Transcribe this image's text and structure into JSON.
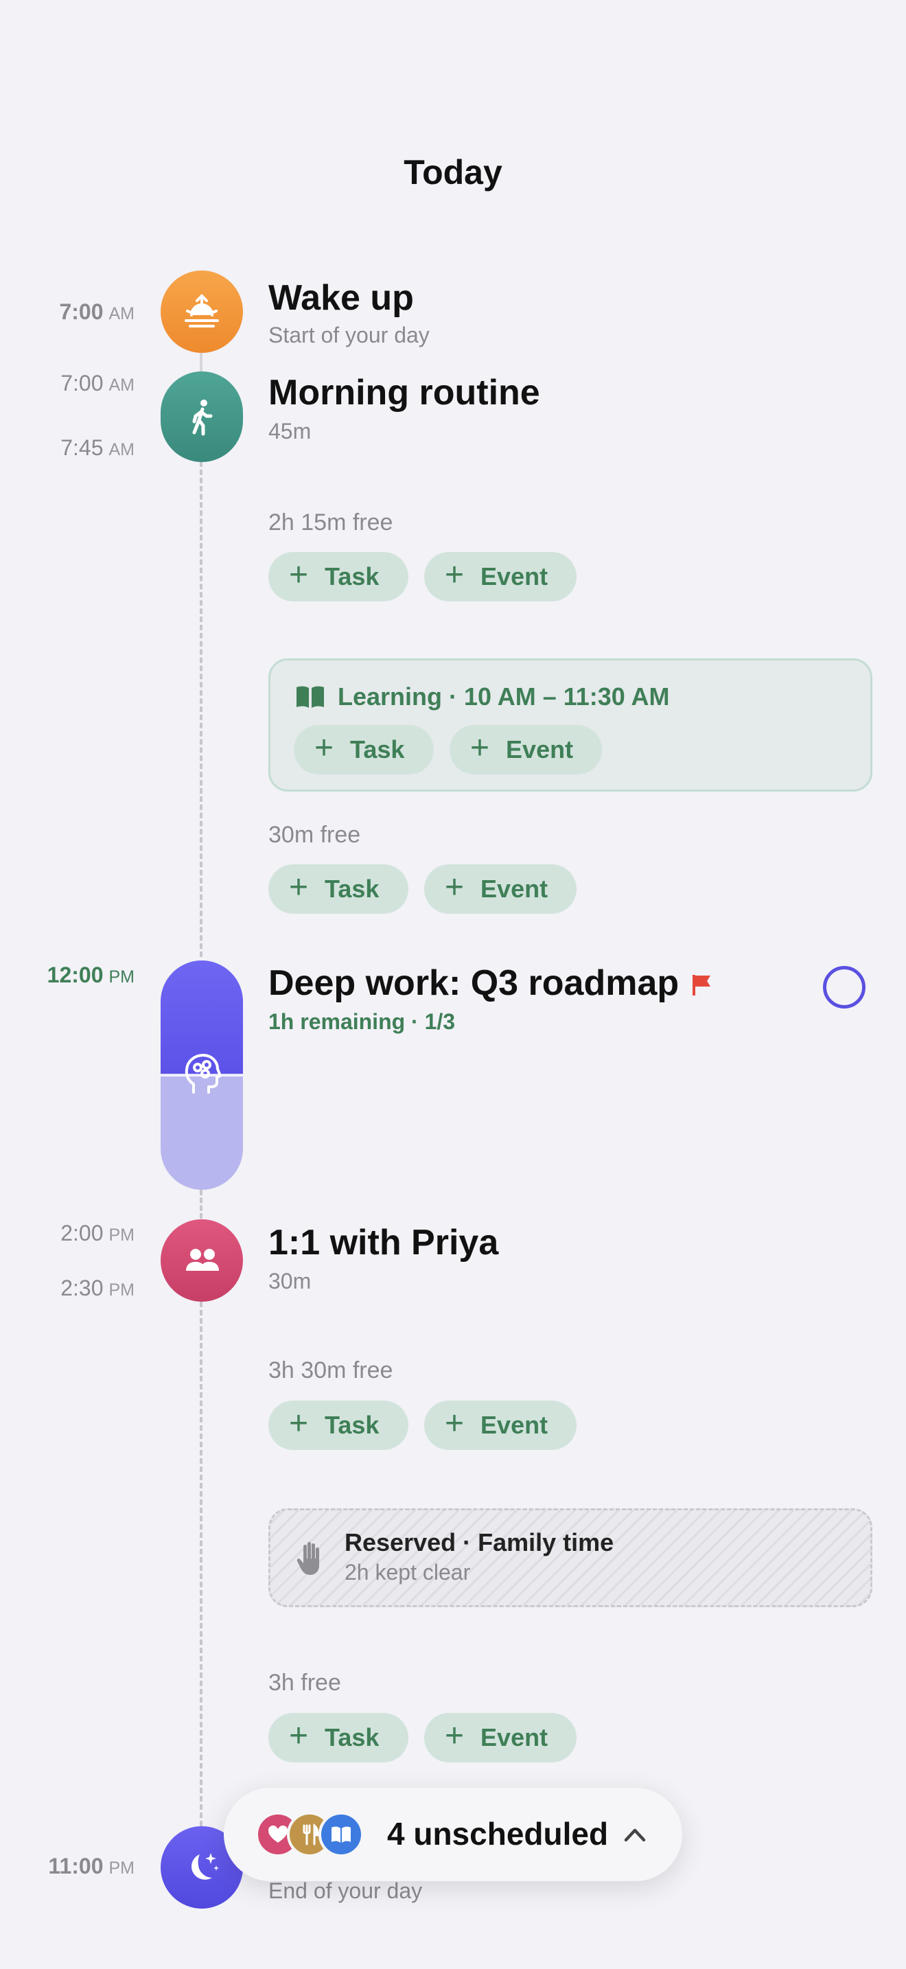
{
  "header": {
    "title": "Today"
  },
  "timeline": {
    "wake": {
      "time": "7:00",
      "ampm": "AM",
      "title": "Wake up",
      "subtitle": "Start of your day",
      "icon": "sunrise-icon",
      "color": "#f0963a"
    },
    "routine": {
      "start": "7:00",
      "start_ampm": "AM",
      "end": "7:45",
      "end_ampm": "AM",
      "title": "Morning routine",
      "subtitle": "45m",
      "icon": "walking-person-icon",
      "color": "#3e9485"
    },
    "free1": {
      "label": "2h 15m free",
      "task": "Task",
      "event": "Event"
    },
    "learning": {
      "label": "Learning · 10 AM – 11:30 AM",
      "task": "Task",
      "event": "Event",
      "icon": "book-icon"
    },
    "free2": {
      "label": "30m free",
      "task": "Task",
      "event": "Event"
    },
    "deepwork": {
      "time": "12:00",
      "ampm": "PM",
      "title": "Deep work: Q3 roadmap",
      "subtitle": "1h remaining · 1/3",
      "icon": "brain-head-icon",
      "progress": 0.5,
      "color": "#5c52e8"
    },
    "oneonone": {
      "start": "2:00",
      "start_ampm": "PM",
      "end": "2:30",
      "end_ampm": "PM",
      "title": "1:1 with Priya",
      "subtitle": "30m",
      "icon": "people-icon",
      "color": "#d44a72"
    },
    "free3": {
      "label": "3h 30m free",
      "task": "Task",
      "event": "Event"
    },
    "reserved": {
      "title": "Reserved · Family time",
      "subtitle": "2h kept clear",
      "icon": "hand-icon"
    },
    "free4": {
      "label": "3h free",
      "task": "Task",
      "event": "Event"
    },
    "bedtime": {
      "time": "11:00",
      "ampm": "PM",
      "subtitle": "End of your day",
      "icon": "moon-stars-icon",
      "color": "#5a50e0"
    }
  },
  "unscheduled": {
    "label": "4 unscheduled",
    "icons": [
      "heart-icon",
      "fork-knife-icon",
      "book-icon"
    ],
    "colors": [
      "#d44a72",
      "#c0954a",
      "#3d7be0"
    ]
  }
}
